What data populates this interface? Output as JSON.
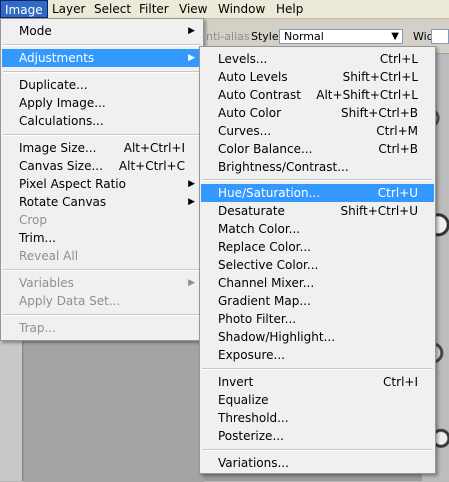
{
  "menubar": [
    "Image",
    "Layer",
    "Select",
    "Filter",
    "View",
    "Window",
    "Help"
  ],
  "options": {
    "antialias_label": "nti-alias",
    "style_label": "Style:",
    "style_value": "Normal",
    "width_label": "Width:"
  },
  "image_menu": {
    "items": [
      {
        "label": "Mode",
        "shortcut": "",
        "submenu": true,
        "disabled": false
      },
      {
        "label": "Adjustments",
        "shortcut": "",
        "submenu": true,
        "disabled": false,
        "highlighted": true
      },
      {
        "label": "Duplicate...",
        "shortcut": "",
        "submenu": false,
        "disabled": false
      },
      {
        "label": "Apply Image...",
        "shortcut": "",
        "submenu": false,
        "disabled": false
      },
      {
        "label": "Calculations...",
        "shortcut": "",
        "submenu": false,
        "disabled": false
      },
      {
        "label": "Image Size...",
        "shortcut": "Alt+Ctrl+I",
        "submenu": false,
        "disabled": false
      },
      {
        "label": "Canvas Size...",
        "shortcut": "Alt+Ctrl+C",
        "submenu": false,
        "disabled": false
      },
      {
        "label": "Pixel Aspect Ratio",
        "shortcut": "",
        "submenu": true,
        "disabled": false
      },
      {
        "label": "Rotate Canvas",
        "shortcut": "",
        "submenu": true,
        "disabled": false
      },
      {
        "label": "Crop",
        "shortcut": "",
        "submenu": false,
        "disabled": true
      },
      {
        "label": "Trim...",
        "shortcut": "",
        "submenu": false,
        "disabled": false
      },
      {
        "label": "Reveal All",
        "shortcut": "",
        "submenu": false,
        "disabled": true
      },
      {
        "label": "Variables",
        "shortcut": "",
        "submenu": true,
        "disabled": true
      },
      {
        "label": "Apply Data Set...",
        "shortcut": "",
        "submenu": false,
        "disabled": true
      },
      {
        "label": "Trap...",
        "shortcut": "",
        "submenu": false,
        "disabled": true
      }
    ]
  },
  "adjustments_menu": {
    "items": [
      {
        "label": "Levels...",
        "shortcut": "Ctrl+L"
      },
      {
        "label": "Auto Levels",
        "shortcut": "Shift+Ctrl+L"
      },
      {
        "label": "Auto Contrast",
        "shortcut": "Alt+Shift+Ctrl+L"
      },
      {
        "label": "Auto Color",
        "shortcut": "Shift+Ctrl+B"
      },
      {
        "label": "Curves...",
        "shortcut": "Ctrl+M"
      },
      {
        "label": "Color Balance...",
        "shortcut": "Ctrl+B"
      },
      {
        "label": "Brightness/Contrast...",
        "shortcut": ""
      },
      {
        "label": "Hue/Saturation...",
        "shortcut": "Ctrl+U",
        "highlighted": true
      },
      {
        "label": "Desaturate",
        "shortcut": "Shift+Ctrl+U"
      },
      {
        "label": "Match Color...",
        "shortcut": ""
      },
      {
        "label": "Replace Color...",
        "shortcut": ""
      },
      {
        "label": "Selective Color...",
        "shortcut": ""
      },
      {
        "label": "Channel Mixer...",
        "shortcut": ""
      },
      {
        "label": "Gradient Map...",
        "shortcut": ""
      },
      {
        "label": "Photo Filter...",
        "shortcut": ""
      },
      {
        "label": "Shadow/Highlight...",
        "shortcut": ""
      },
      {
        "label": "Exposure...",
        "shortcut": ""
      },
      {
        "label": "Invert",
        "shortcut": "Ctrl+I"
      },
      {
        "label": "Equalize",
        "shortcut": ""
      },
      {
        "label": "Threshold...",
        "shortcut": ""
      },
      {
        "label": "Posterize...",
        "shortcut": ""
      },
      {
        "label": "Variations...",
        "shortcut": ""
      }
    ]
  },
  "colors": {
    "highlight": "#3399ff",
    "menubar_active": "#316ac5",
    "disabled_text": "#8f8f8f"
  }
}
